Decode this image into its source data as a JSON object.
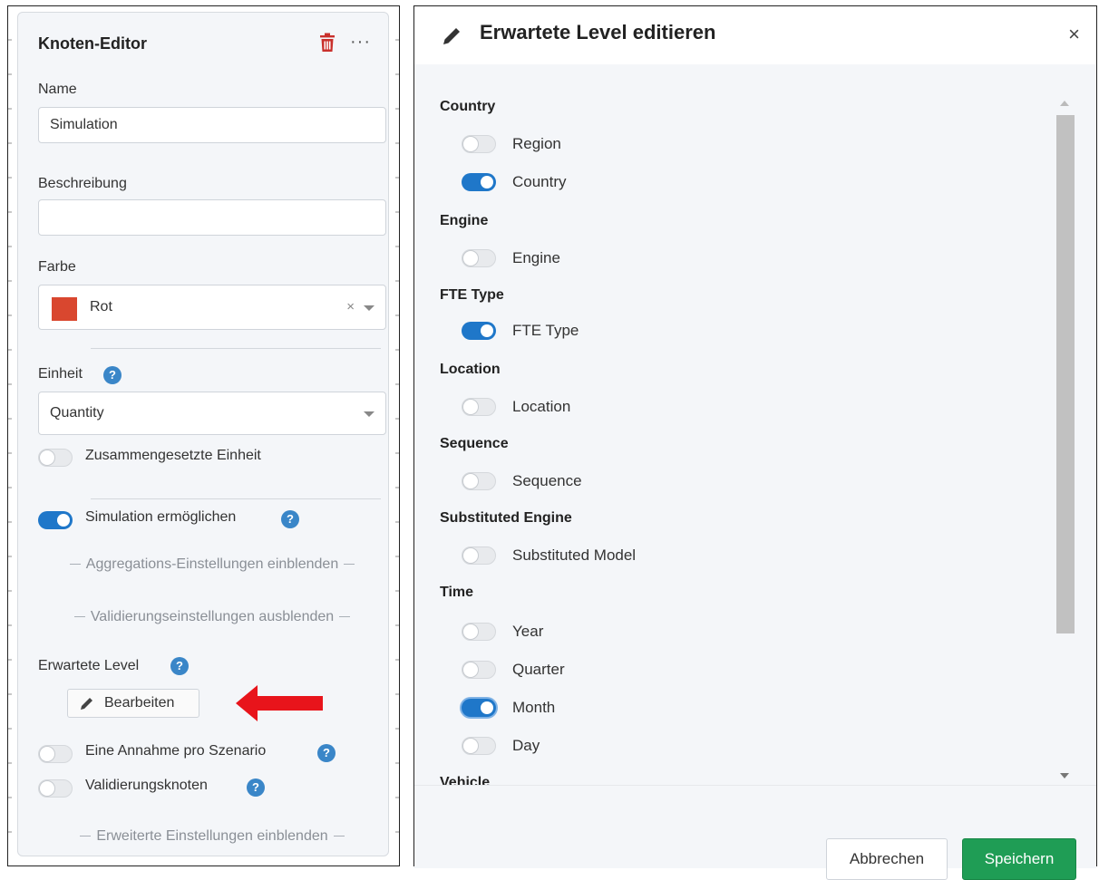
{
  "editor": {
    "title": "Knoten-Editor",
    "name_label": "Name",
    "name_value": "Simulation",
    "description_label": "Beschreibung",
    "description_value": "",
    "color_label": "Farbe",
    "color_value": "Rot",
    "color_hex": "#d9472f",
    "color_clear": "×",
    "unit_label": "Einheit",
    "unit_value": "Quantity",
    "composite_unit_label": "Zusammengesetzte Einheit",
    "composite_unit_on": false,
    "simulation_label": "Simulation ermöglichen",
    "simulation_on": true,
    "aggregation_link": "Aggregations-Einstellungen einblenden",
    "validation_link": "Validierungseinstellungen ausblenden",
    "expected_levels_label": "Erwartete Level",
    "edit_button": "Bearbeiten",
    "assumption_label": "Eine Annahme pro Szenario",
    "assumption_on": false,
    "validation_node_label": "Validierungsknoten",
    "validation_node_on": false,
    "advanced_link": "Erweiterte Einstellungen einblenden",
    "help_glyph": "?",
    "more_glyph": "···",
    "annotation_arrow_color": "#e8141b"
  },
  "dialog": {
    "title": "Erwartete Level editieren",
    "close_glyph": "×",
    "groups": [
      {
        "name": "Country",
        "options": [
          {
            "label": "Region",
            "on": false
          },
          {
            "label": "Country",
            "on": true
          }
        ]
      },
      {
        "name": "Engine",
        "options": [
          {
            "label": "Engine",
            "on": false
          }
        ]
      },
      {
        "name": "FTE Type",
        "options": [
          {
            "label": "FTE Type",
            "on": true
          }
        ]
      },
      {
        "name": "Location",
        "options": [
          {
            "label": "Location",
            "on": false
          }
        ]
      },
      {
        "name": "Sequence",
        "options": [
          {
            "label": "Sequence",
            "on": false
          }
        ]
      },
      {
        "name": "Substituted Engine",
        "options": [
          {
            "label": "Substituted Model",
            "on": false
          }
        ]
      },
      {
        "name": "Time",
        "options": [
          {
            "label": "Year",
            "on": false
          },
          {
            "label": "Quarter",
            "on": false
          },
          {
            "label": "Month",
            "on": true
          },
          {
            "label": "Day",
            "on": false
          }
        ]
      },
      {
        "name": "Vehicle",
        "options": []
      }
    ],
    "cancel_button": "Abbrechen",
    "save_button": "Speichern",
    "accent_color": "#1f77c9",
    "save_color": "#1f9d55"
  }
}
